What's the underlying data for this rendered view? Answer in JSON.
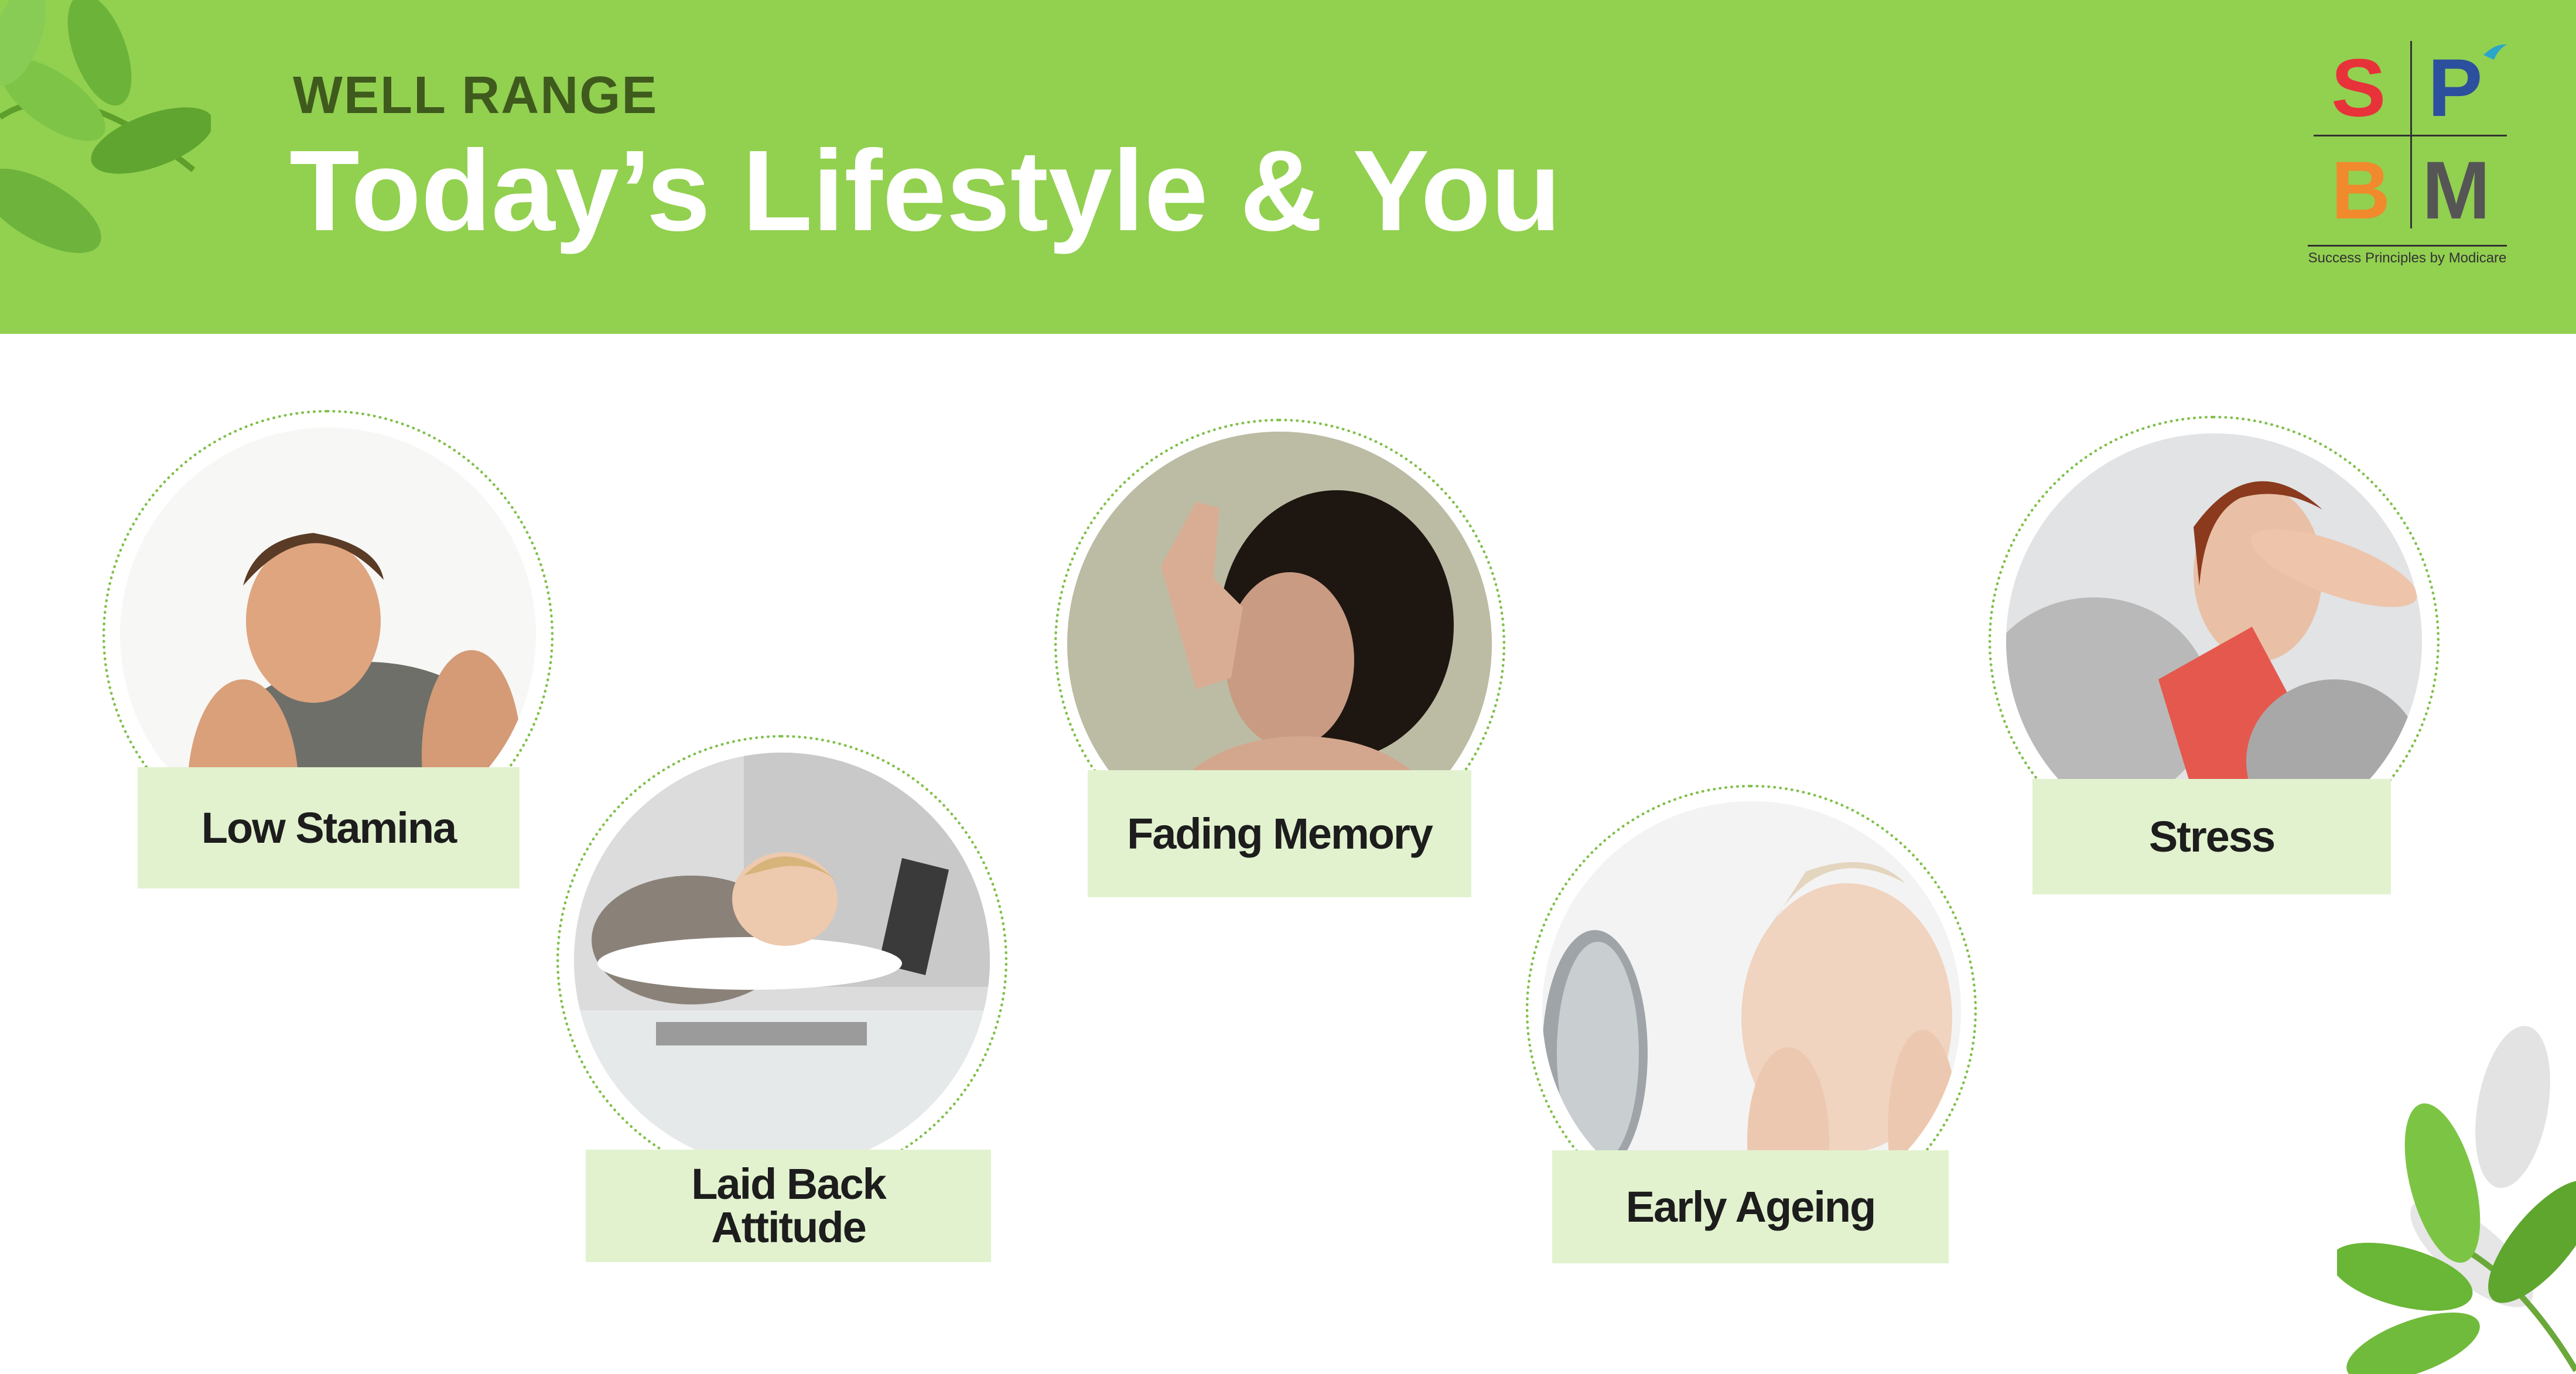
{
  "header": {
    "subtitle": "WELL RANGE",
    "title": "Today’s Lifestyle & You"
  },
  "logo": {
    "letters": [
      "S",
      "P",
      "B",
      "M"
    ],
    "tagline": "Success Principles by Modicare",
    "colors": {
      "S": "#e8323a",
      "P": "#2c4f9e",
      "B": "#f08a2c",
      "M": "#555555"
    }
  },
  "colors": {
    "header_bg": "#92d050",
    "subtitle": "#3f5a1d",
    "label_bg": "#e2f2cf",
    "ring": "#7fc04a"
  },
  "cards": [
    {
      "label": "Low Stamina",
      "icon": "tired-man-photo"
    },
    {
      "label": "Laid Back Attitude",
      "icon": "sleeping-at-desk-photo"
    },
    {
      "label": "Fading Memory",
      "icon": "forgetful-woman-photo"
    },
    {
      "label": "Early Ageing",
      "icon": "woman-mirror-photo"
    },
    {
      "label": "Stress",
      "icon": "stressed-woman-photo"
    }
  ]
}
